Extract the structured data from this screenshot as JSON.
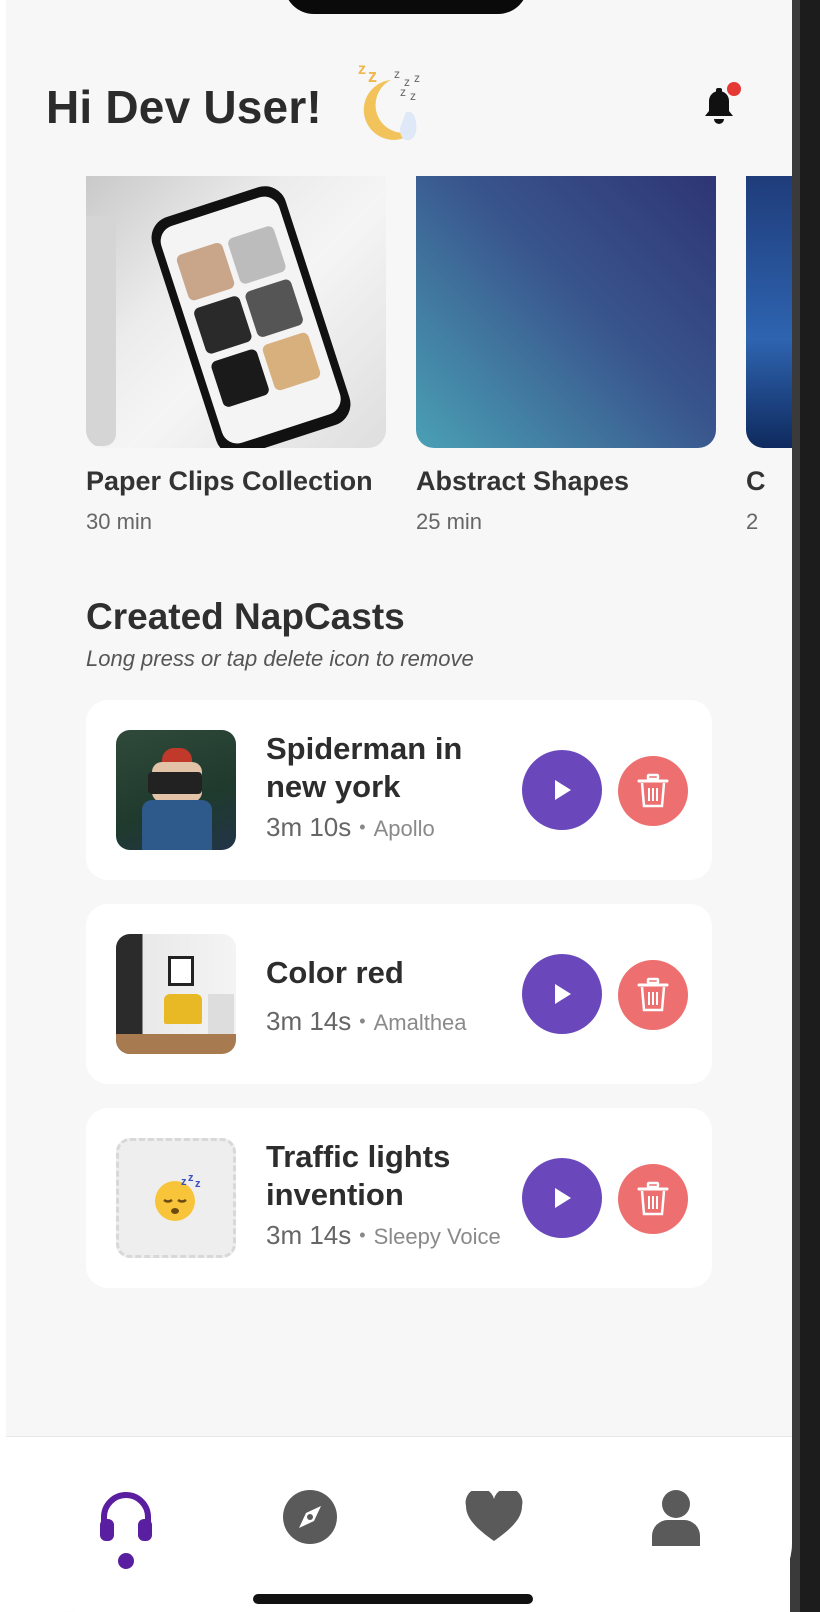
{
  "header": {
    "greeting": "Hi Dev User!",
    "sleep_icon": "sleeping-moon-icon",
    "notification_icon": "bell-icon",
    "has_notification": true
  },
  "featured": [
    {
      "title": "Paper Clips Collection",
      "duration": "30 min"
    },
    {
      "title": "Abstract Shapes",
      "duration": "25 min"
    },
    {
      "title": "C",
      "duration": "2"
    }
  ],
  "created_section": {
    "title": "Created NapCasts",
    "subtitle": "Long press or tap delete icon to remove"
  },
  "napcasts": [
    {
      "title": "Spiderman in new york",
      "duration": "3m 10s",
      "voice": "Apollo",
      "thumb": "photo-camera-woman"
    },
    {
      "title": "Color red",
      "duration": "3m 14s",
      "voice": "Amalthea",
      "thumb": "photo-yellow-chair"
    },
    {
      "title": "Traffic lights invention",
      "duration": "3m 14s",
      "voice": "Sleepy Voice",
      "thumb": "sleepy-emoji-placeholder"
    }
  ],
  "bottom_nav": [
    {
      "name": "headphones-icon",
      "active": true
    },
    {
      "name": "compass-icon",
      "active": false
    },
    {
      "name": "heart-icon",
      "active": false
    },
    {
      "name": "profile-icon",
      "active": false
    }
  ],
  "colors": {
    "accent": "#6a48bc",
    "delete": "#ee6f6f",
    "nav_active": "#5a1fa0",
    "nav_inactive": "#5a5a5a",
    "notification_dot": "#e53935"
  }
}
